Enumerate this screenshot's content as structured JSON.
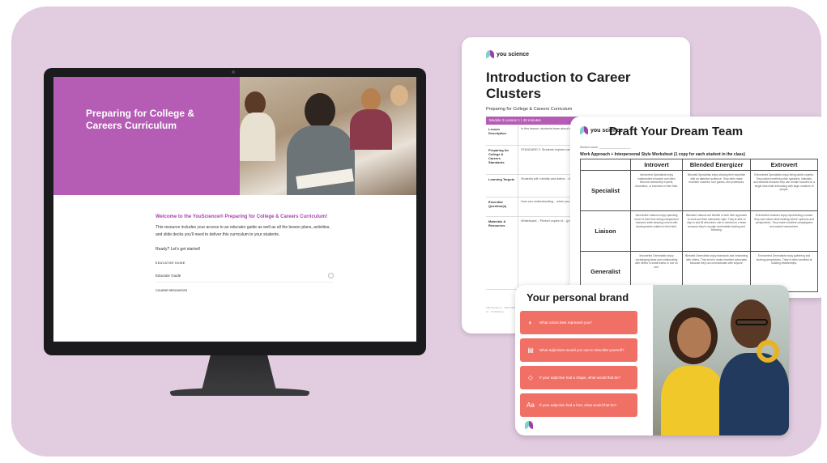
{
  "monitor": {
    "hero_title": "Preparing for College & Careers Curriculum",
    "welcome": "Welcome to the YouScience® Preparing for College & Careers Curriculum!",
    "intro": "This resource includes your access to an educator guide as well as all the lesson plans, activities, and slide decks you'll need to deliver this curriculum to your students.",
    "ready": "Ready? Let's get started!",
    "educator_section": "EDUCATOR GUIDE",
    "educator_link": "Educator Guide",
    "course_section": "COURSE RESOURCES"
  },
  "doc1": {
    "logo": "you science",
    "title": "Introduction to Career Clusters",
    "subtitle": "Preparing for College & Careers Curriculum",
    "module": "Module 3 Lesson 1 | 40 minutes",
    "rows": [
      {
        "label": "Lesson Description",
        "text": "In this lesson, students learn about career pathways and clusters, how careers are organized into groups by..."
      },
      {
        "label": "Preparing for College & Careers Standards",
        "text": "STANDARD 2: Students explore careers, colleges, and career pathways that help them further define..."
      },
      {
        "label": "Learning Targets",
        "text": "Students will: Identify and define... diverse professional... attributes."
      },
      {
        "label": "Essential Question(s)",
        "text": "How can understanding... when you are exploring..."
      },
      {
        "label": "Materials & Resources",
        "text": "Whiteboard... Printed copies of... (provided) Index cards or paper... Digital or printed... Reading..."
      }
    ],
    "footer": "This license to... 2021-2022 school... rights of... YouScience..."
  },
  "doc2": {
    "logo": "you science",
    "title": "Draft Your Dream Team",
    "student_name": "Student name: ____________________",
    "subtitle": "Work Approach + Interpersonal Style Worksheet (1 copy for each student in the class)",
    "columns": [
      "Introvert",
      "Blended Energizer",
      "Extrovert"
    ],
    "rows": [
      {
        "label": "Specialist",
        "cells": [
          "Introverted Specialists enjoy independent research and often become noteworthy experts, innovators, or inventors in their field.",
          "Blended Specialists enjoy sharing their expertise with an attentive audience. They often make excellent coaches, tour guides, and professors.",
          "Extroverted Specialists enjoy being public experts. They make excellent public speakers, lobbyists, and activists because they can remain focused on a single idea while interacting with large numbers of people."
        ]
      },
      {
        "label": "Liaison",
        "cells": [
          "Introverted Liaisons enjoy spending much of their time doing independent research while keeping current with developments related to their field.",
          "Blended Liaisons are flexible in both their approach to work and their interaction style. They're able to step in and fill whichever role is needed on a team because they're equally comfortable leading and following.",
          "Extroverted Liaisons enjoy representing a cause they care about while treating others' opinions and perspectives. They make excellent campaigners and market researchers."
        ]
      },
      {
        "label": "Generalist",
        "cells": [
          "Introverted Generalists enjoy exchanging ideas and collaborating with others in small teams or one on one.",
          "Blended Generalists enjoy teamwork and networking with others. They tend to make excellent advocates because they can communicate with anyone.",
          "Extroverted Generalists enjoy gathering and sharing perspectives. They're often excellent at building relationships."
        ]
      }
    ]
  },
  "doc3": {
    "title": "Your personal brand",
    "items": [
      {
        "icon": "palette-icon",
        "glyph": "◐",
        "text": "What colors best represent you?"
      },
      {
        "icon": "clipboard-icon",
        "glyph": "▤",
        "text": "What adjectives would you use to describe yourself?"
      },
      {
        "icon": "diamond-icon",
        "glyph": "◇",
        "text": "If your adjective had a shape, what would that be?"
      },
      {
        "icon": "font-icon",
        "glyph": "Aa",
        "text": "If your adjective had a font, what would that be?"
      }
    ]
  },
  "colors": {
    "background": "#e2cce0",
    "accent_purple": "#b55db4",
    "coral": "#f07066",
    "monitor": "#1b1b1d"
  }
}
